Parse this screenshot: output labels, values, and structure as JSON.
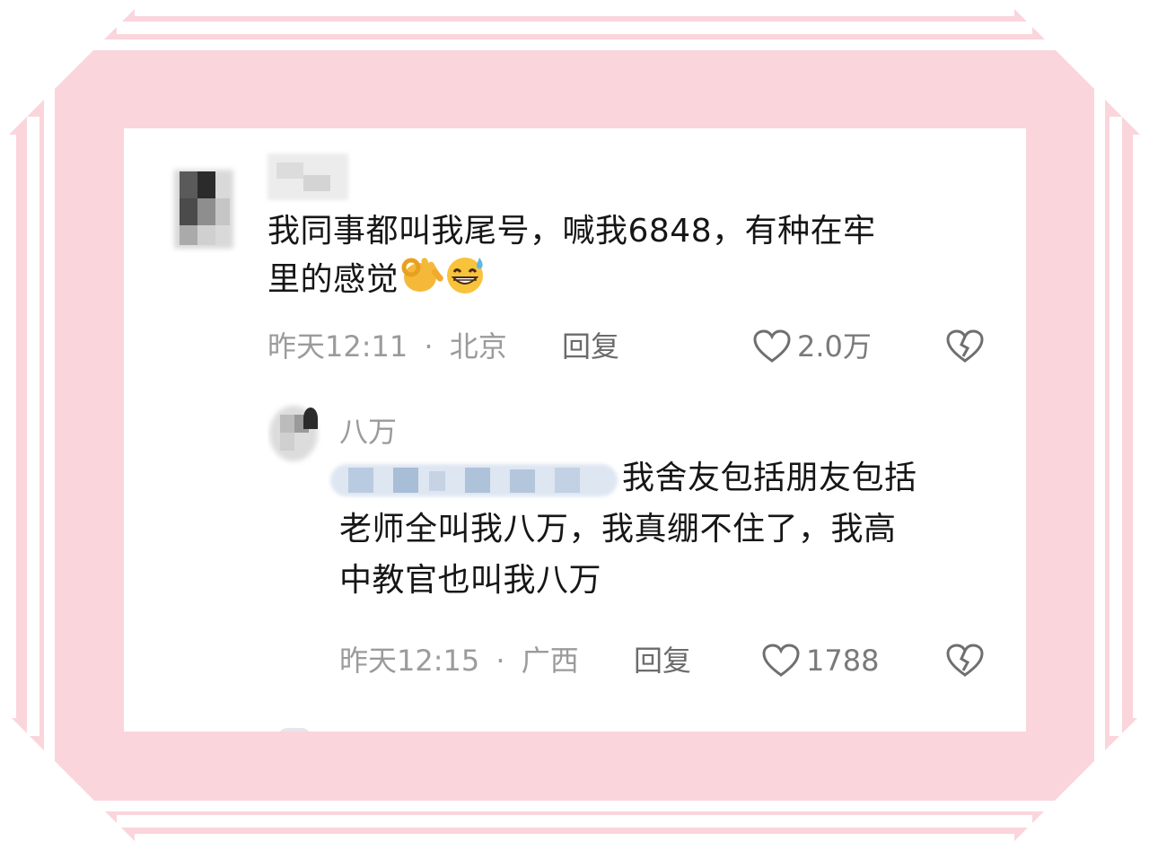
{
  "colors": {
    "frame_pink": "#fbd5dc",
    "frame_stripe": "#ffffff",
    "text": "#161616",
    "meta": "#9b9b9b"
  },
  "comments": [
    {
      "author_blurred": true,
      "text_line1": "我同事都叫我尾号，喊我6848，有种在牢",
      "text_line2": "里的感觉",
      "emojis": [
        "ok-hand-icon",
        "grinning-sweat-icon"
      ],
      "time": "昨天12:11",
      "separator": "·",
      "location": "北京",
      "reply_label": "回复",
      "likes": "2.0万",
      "like_icon": "heart-outline-icon",
      "dislike_icon": "broken-heart-icon"
    }
  ],
  "replies": [
    {
      "author": "八万",
      "mention_blurred": true,
      "text_line1": "我舍友包括朋友包括",
      "text_line2": "老师全叫我八万，我真绷不住了，我高",
      "text_line3": "中教官也叫我八万",
      "time": "昨天12:15",
      "separator": "·",
      "location": "广西",
      "reply_label": "回复",
      "likes": "1788",
      "like_icon": "heart-outline-icon",
      "dislike_icon": "broken-heart-icon"
    }
  ]
}
